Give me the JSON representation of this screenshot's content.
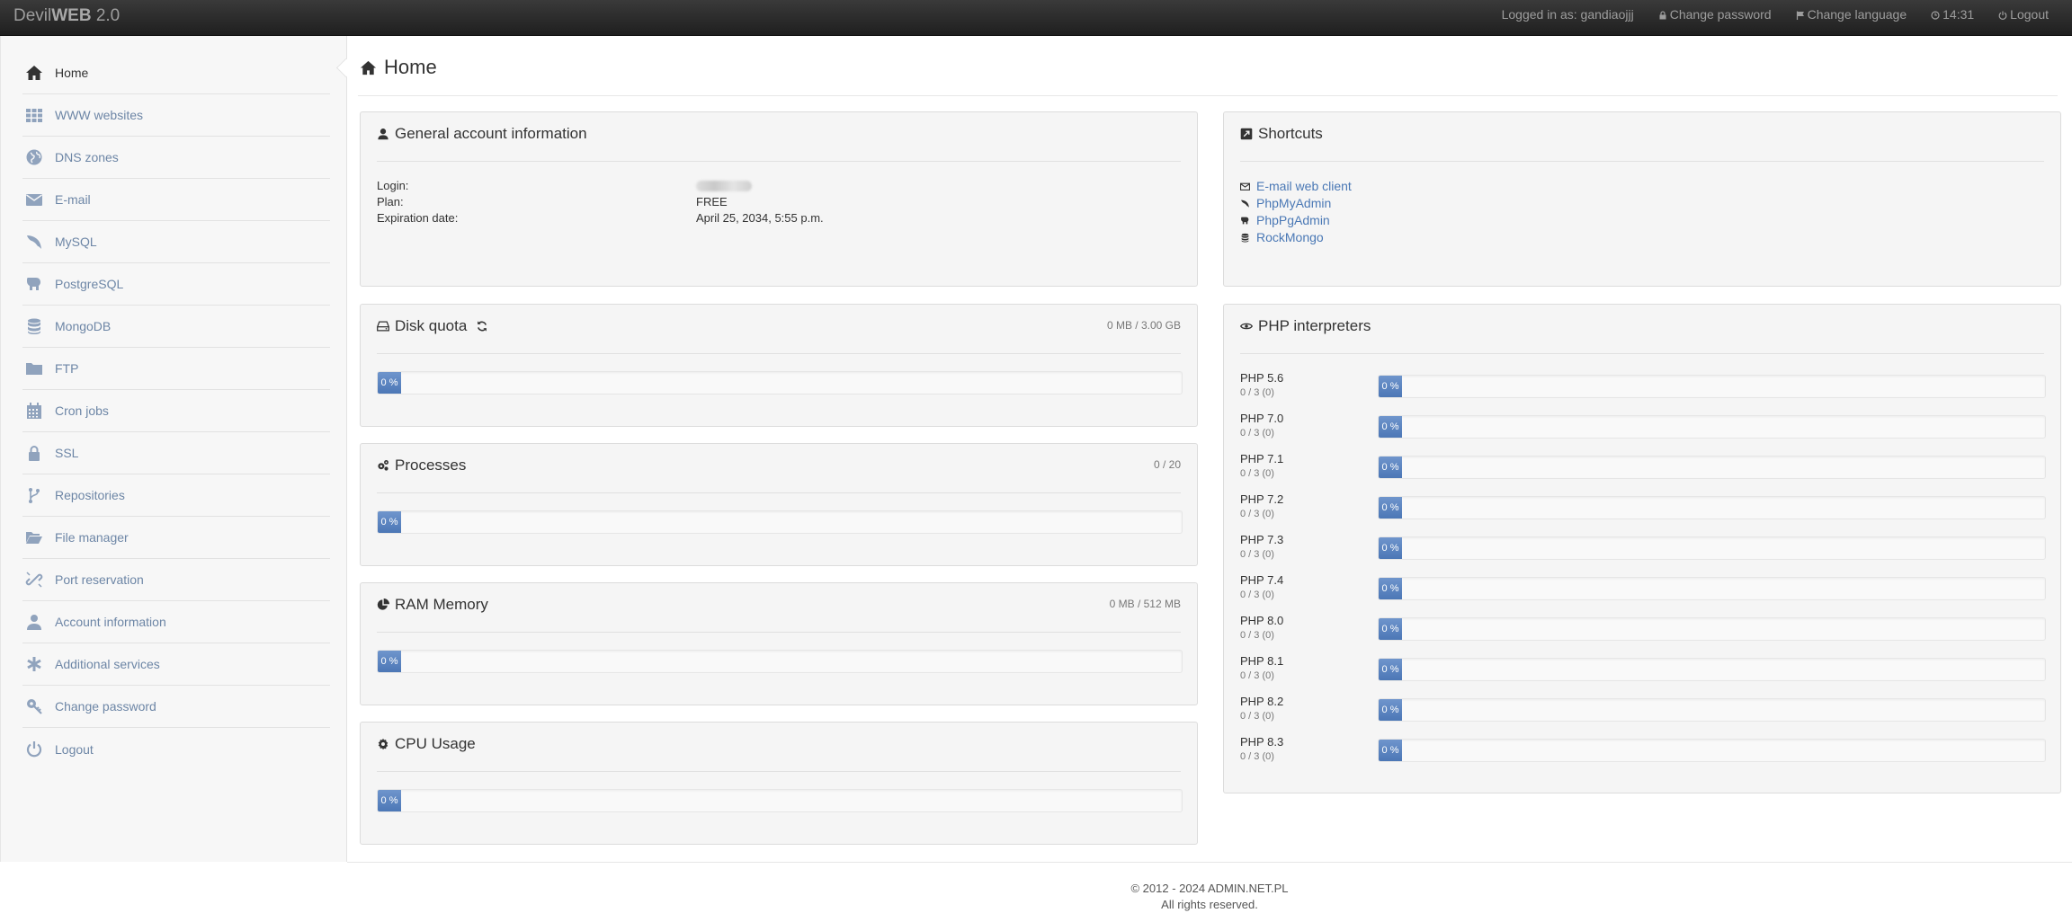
{
  "navbar": {
    "brand_plain": "Devil",
    "brand_bold": "WEB",
    "brand_version": " 2.0",
    "logged_in": "Logged in as: gandiaojjj",
    "change_password": "Change password",
    "change_language": "Change language",
    "time": "14:31",
    "logout": "Logout"
  },
  "sidebar": {
    "items": [
      {
        "label": "Home",
        "icon": "home-icon",
        "active": true
      },
      {
        "label": "WWW websites",
        "icon": "grid-icon"
      },
      {
        "label": "DNS zones",
        "icon": "globe-icon"
      },
      {
        "label": "E-mail",
        "icon": "envelope-icon"
      },
      {
        "label": "MySQL",
        "icon": "dolphin-icon"
      },
      {
        "label": "PostgreSQL",
        "icon": "elephant-icon"
      },
      {
        "label": "MongoDB",
        "icon": "database-icon"
      },
      {
        "label": "FTP",
        "icon": "folder-icon"
      },
      {
        "label": "Cron jobs",
        "icon": "calendar-icon"
      },
      {
        "label": "SSL",
        "icon": "lock-icon"
      },
      {
        "label": "Repositories",
        "icon": "branch-icon"
      },
      {
        "label": "File manager",
        "icon": "folder-open-icon"
      },
      {
        "label": "Port reservation",
        "icon": "link-icon"
      },
      {
        "label": "Account information",
        "icon": "user-icon"
      },
      {
        "label": "Additional services",
        "icon": "asterisk-icon"
      },
      {
        "label": "Change password",
        "icon": "key-icon"
      },
      {
        "label": "Logout",
        "icon": "power-icon"
      }
    ]
  },
  "main": {
    "title": "Home",
    "account": {
      "title": "General account information",
      "login_label": "Login:",
      "plan_label": "Plan:",
      "plan_value": "FREE",
      "expiration_label": "Expiration date:",
      "expiration_value": "April 25, 2034, 5:55 p.m."
    },
    "disk": {
      "title": "Disk quota",
      "usage": "0 MB / 3.00 GB",
      "percent_label": "0 %",
      "percent": 0
    },
    "processes": {
      "title": "Processes",
      "usage": "0 / 20",
      "percent_label": "0 %",
      "percent": 0
    },
    "ram": {
      "title": "RAM Memory",
      "usage": "0 MB / 512 MB",
      "percent_label": "0 %",
      "percent": 0
    },
    "cpu": {
      "title": "CPU Usage",
      "percent_label": "0 %",
      "percent": 0
    },
    "shortcuts": {
      "title": "Shortcuts",
      "items": [
        {
          "label": "E-mail web client",
          "icon": "envelope-icon"
        },
        {
          "label": "PhpMyAdmin",
          "icon": "dolphin-icon"
        },
        {
          "label": "PhpPgAdmin",
          "icon": "elephant-icon"
        },
        {
          "label": "RockMongo",
          "icon": "database-icon"
        }
      ]
    },
    "php": {
      "title": "PHP interpreters",
      "items": [
        {
          "name": "PHP 5.6",
          "sub": "0 / 3 (0)",
          "percent_label": "0 %",
          "percent": 0
        },
        {
          "name": "PHP 7.0",
          "sub": "0 / 3 (0)",
          "percent_label": "0 %",
          "percent": 0
        },
        {
          "name": "PHP 7.1",
          "sub": "0 / 3 (0)",
          "percent_label": "0 %",
          "percent": 0
        },
        {
          "name": "PHP 7.2",
          "sub": "0 / 3 (0)",
          "percent_label": "0 %",
          "percent": 0
        },
        {
          "name": "PHP 7.3",
          "sub": "0 / 3 (0)",
          "percent_label": "0 %",
          "percent": 0
        },
        {
          "name": "PHP 7.4",
          "sub": "0 / 3 (0)",
          "percent_label": "0 %",
          "percent": 0
        },
        {
          "name": "PHP 8.0",
          "sub": "0 / 3 (0)",
          "percent_label": "0 %",
          "percent": 0
        },
        {
          "name": "PHP 8.1",
          "sub": "0 / 3 (0)",
          "percent_label": "0 %",
          "percent": 0
        },
        {
          "name": "PHP 8.2",
          "sub": "0 / 3 (0)",
          "percent_label": "0 %",
          "percent": 0
        },
        {
          "name": "PHP 8.3",
          "sub": "0 / 3 (0)",
          "percent_label": "0 %",
          "percent": 0
        }
      ]
    }
  },
  "footer": {
    "copyright": "© 2012 - 2024 ADMIN.NET.PL",
    "rights": "All rights reserved."
  },
  "colors": {
    "accent": "#4c77b6",
    "link": "#4a78b5",
    "navbar": "#222222"
  }
}
